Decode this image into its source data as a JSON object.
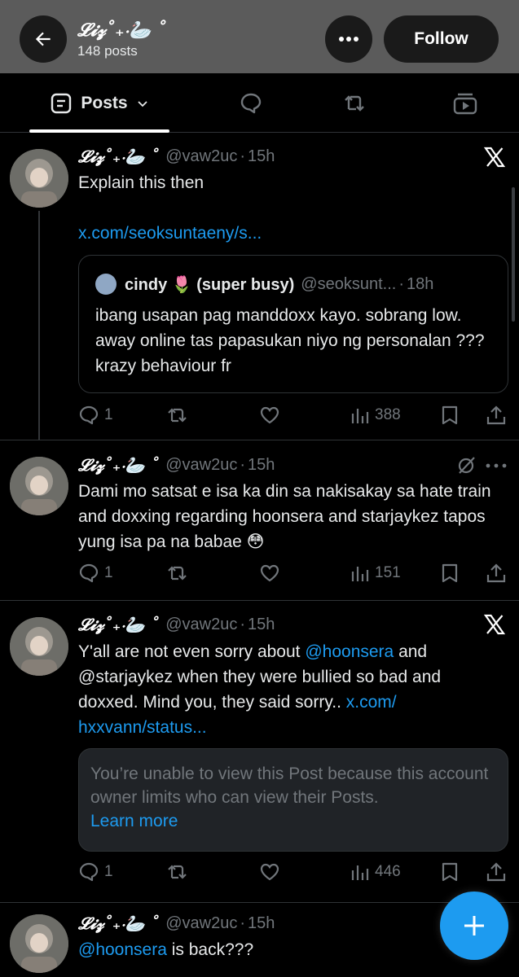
{
  "header": {
    "name": "𝓛𝓲𝔃˚₊‧🦢 ˚",
    "posts_count": "148 posts",
    "follow_label": "Follow",
    "background": "#5b5b5b"
  },
  "tabs": {
    "posts_label": "Posts"
  },
  "colors": {
    "accent": "#1d9bf0",
    "muted": "#71767b",
    "text": "#e7e9ea"
  },
  "posts": [
    {
      "name": "𝓛𝓲𝔃˚₊‧🦢 ˚",
      "handle": "@vaw2uc",
      "dot": "·",
      "time": "15h",
      "text": "Explain this then",
      "link": "x.com/seoksuntaeny/s...",
      "quote": {
        "name": "cindy 🌷 (super busy)",
        "handle": "@seoksunt...",
        "dot": "·",
        "time": "18h",
        "text": "ibang usapan pag manddoxx kayo. sobrang low. away online tas papasukan niyo ng personalan ??? krazy behaviour fr"
      },
      "replies": "1",
      "views": "388"
    },
    {
      "name": "𝓛𝓲𝔃˚₊‧🦢 ˚",
      "handle": "@vaw2uc",
      "dot": "·",
      "time": "15h",
      "text": "Dami mo satsat e isa ka din sa nakisakay sa hate train and doxxing regarding hoonsera and starjaykez tapos yung isa pa na babae 😳",
      "replies": "1",
      "views": "151"
    },
    {
      "name": "𝓛𝓲𝔃˚₊‧🦢 ˚",
      "handle": "@vaw2uc",
      "dot": "·",
      "time": "15h",
      "text_before": "Y'all are not even sorry about ",
      "mention": "@hoonsera",
      "text_after": " and @starjaykez when they were bullied so bad and doxxed. Mind you, they said sorry.. ",
      "link1": "x.com/",
      "link2": "hxxvann/status...",
      "restricted_msg": "You’re unable to view this Post because this account owner limits who can view their Posts.",
      "learn_more": "Learn more",
      "replies": "1",
      "views": "446"
    },
    {
      "name": "𝓛𝓲𝔃˚₊‧🦢 ˚",
      "handle": "@vaw2uc",
      "dot": "·",
      "time": "15h",
      "mention": "@hoonsera",
      "text_after": " is back???"
    }
  ]
}
